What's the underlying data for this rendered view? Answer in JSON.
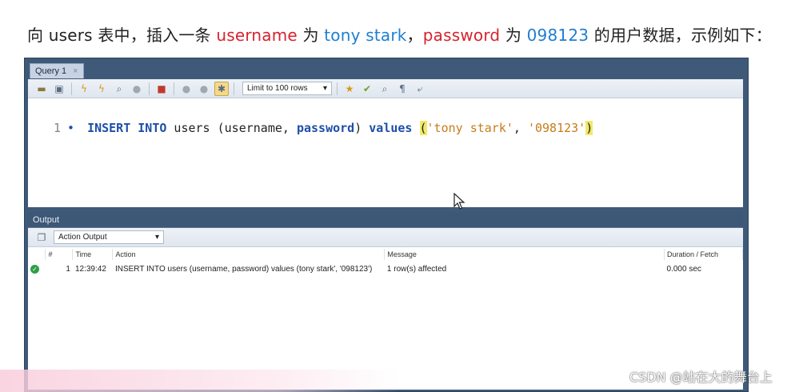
{
  "caption": {
    "prefix": "向 users 表中，插入一条 ",
    "field1": "username",
    "mid1": " 为 ",
    "value1": "tony stark",
    "comma": "，",
    "field2": "password",
    "mid2": " 为 ",
    "value2": "098123",
    "suffix": " 的用户数据，示例如下："
  },
  "query_tab": {
    "label": "Query 1",
    "close": "×"
  },
  "toolbar": {
    "limit_label": "Limit to 100 rows",
    "icons": [
      "folder-icon",
      "save-icon",
      "execute-icon",
      "execute-current-icon",
      "explain-icon",
      "stop-icon",
      "toggle-error-icon",
      "commit-icon",
      "rollback-icon",
      "autocommit-icon",
      "beautify-icon",
      "find-icon",
      "invisible-chars-icon",
      "wrap-icon"
    ]
  },
  "editor": {
    "line_number": "1",
    "bullet": "•",
    "kw_insert": "INSERT INTO",
    "table": " users (username, ",
    "kw_password": "password",
    "close_paren": ") ",
    "kw_values": "values",
    "space": " ",
    "open_paren": "(",
    "str1": "'tony stark'",
    "sep": ", ",
    "str2": "'098123'",
    "end_paren": ")"
  },
  "output": {
    "header": "Output",
    "dropdown": "Action Output",
    "columns": [
      "#",
      "Time",
      "Action",
      "Message",
      "Duration / Fetch"
    ],
    "rows": [
      {
        "status": "success",
        "num": "1",
        "time": "12:39:42",
        "action": "INSERT INTO users (username, password) values (tony stark', '098123')",
        "message": "1 row(s) affected",
        "duration": "0.000 sec"
      }
    ]
  },
  "watermark": "CSDN @站在大的舞台上",
  "colors": {
    "accent_red": "#d6232f",
    "accent_blue": "#1f7fd1",
    "frame": "#3f5a78",
    "success": "#2ea043"
  }
}
